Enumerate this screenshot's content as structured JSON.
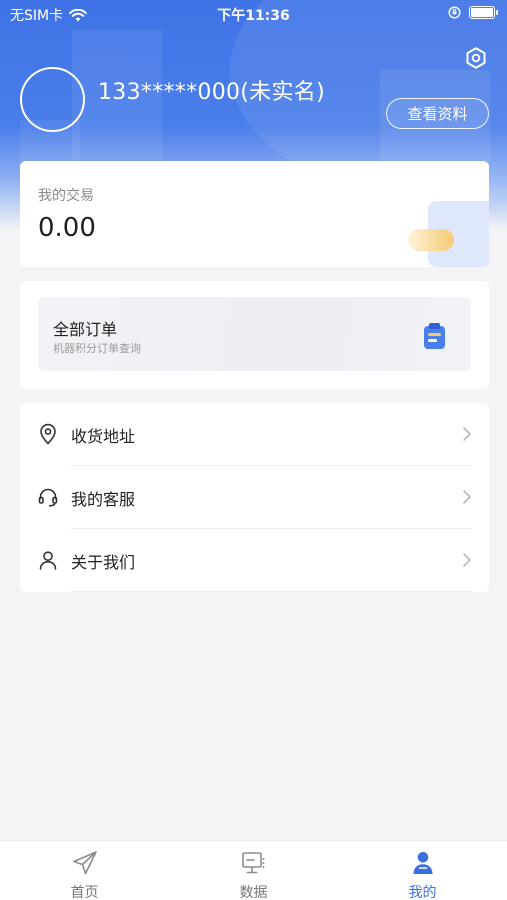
{
  "status_bar": {
    "carrier": "无SIM卡",
    "time": "下午11:36"
  },
  "profile": {
    "phone": "133*****000(未实名)",
    "view_profile_label": "查看资料"
  },
  "trade": {
    "label": "我的交易",
    "value": "0.00"
  },
  "orders": {
    "title": "全部订单",
    "subtitle": "机器积分订单查询"
  },
  "menu": {
    "items": [
      {
        "label": "收货地址",
        "icon": "location-pin-icon"
      },
      {
        "label": "我的客服",
        "icon": "headset-icon"
      },
      {
        "label": "关于我们",
        "icon": "user-icon"
      }
    ]
  },
  "tabbar": {
    "tabs": [
      {
        "label": "首页",
        "icon": "paper-plane-icon",
        "active": false
      },
      {
        "label": "数据",
        "icon": "monitor-icon",
        "active": false
      },
      {
        "label": "我的",
        "icon": "person-icon",
        "active": true
      }
    ]
  },
  "colors": {
    "primary": "#3f73e6",
    "active_tab": "#3a6fe2",
    "background": "#f4f4f6"
  }
}
